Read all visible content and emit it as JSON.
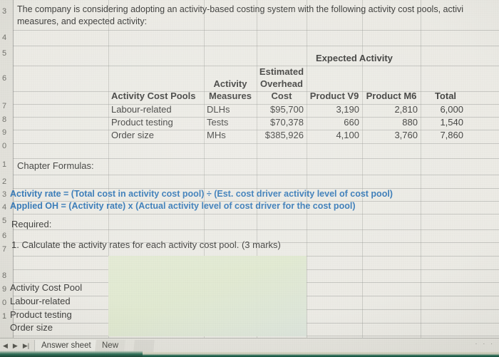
{
  "app": {
    "type": "spreadsheet"
  },
  "prompt": {
    "line1": "The company is considering adopting an activity-based costing system with the following activity cost pools, activi",
    "line2": "measures, and expected activity:"
  },
  "table": {
    "group_header": "Expected Activity",
    "headers": {
      "pools": "Activity Cost Pools",
      "measures_l1": "Activity",
      "measures_l2": "Measures",
      "cost_l1": "Estimated",
      "cost_l2": "Overhead",
      "cost_l3": "Cost",
      "product_v9": "Product V9",
      "product_m6": "Product M6",
      "total": "Total"
    },
    "rows": [
      {
        "pool": "Labour-related",
        "measure": "DLHs",
        "cost": "$95,700",
        "v9": "3,190",
        "m6": "2,810",
        "total": "6,000"
      },
      {
        "pool": "Product testing",
        "measure": "Tests",
        "cost": "$70,378",
        "v9": "660",
        "m6": "880",
        "total": "1,540"
      },
      {
        "pool": "Order size",
        "measure": "MHs",
        "cost": "$385,926",
        "v9": "4,100",
        "m6": "3,760",
        "total": "7,860"
      }
    ]
  },
  "formulas": {
    "heading": "Chapter Formulas:",
    "line1": "Activity rate = (Total cost in activity cost pool) ÷ (Est. cost driver activity level of cost pool)",
    "line2": "Applied OH = (Activity rate) x (Actual activity level of cost driver for the cost pool)",
    "color": "#2e75b6"
  },
  "required": {
    "heading": "Required:",
    "item1": "1. Calculate the activity rates for each activity cost pool. (3 marks)"
  },
  "answer_area": {
    "header": "Activity Cost Pool",
    "rows": [
      "Labour-related",
      "Product testing",
      "Order size"
    ],
    "highlight_color": "#e2eacf"
  },
  "row_numbers": [
    "3",
    "4",
    "5",
    "6",
    "7",
    "8",
    "9",
    "0",
    "1",
    "2",
    "3",
    "4",
    "5",
    "6",
    "7",
    "8",
    "9",
    "0",
    "1"
  ],
  "tabs": {
    "nav_first": "◀",
    "nav_prev": "▶",
    "nav_last": "▶|",
    "sheets": [
      {
        "label": "Answer sheet",
        "active": true
      },
      {
        "label": "New",
        "active": false
      }
    ]
  },
  "scroll_dots": "· · ·"
}
